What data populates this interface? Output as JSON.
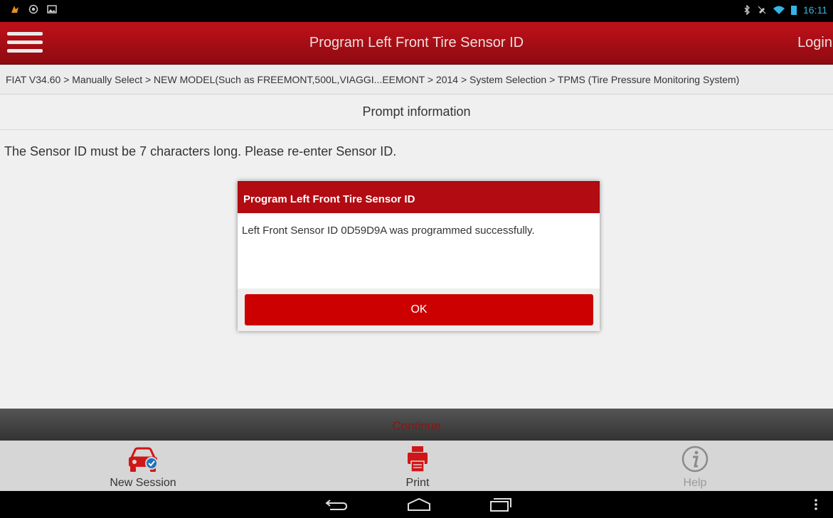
{
  "status_bar": {
    "time": "16:11"
  },
  "header": {
    "title": "Program Left Front Tire Sensor ID",
    "login_label": "Login"
  },
  "breadcrumb": "FIAT V34.60 > Manually Select > NEW MODEL(Such as FREEMONT,500L,VIAGGI...EEMONT > 2014 > System Selection > TPMS (Tire Pressure Monitoring System)",
  "prompt": {
    "heading": "Prompt information",
    "message": "The Sensor ID must be 7 characters long. Please re-enter Sensor ID."
  },
  "dialog": {
    "title": "Program Left Front Tire Sensor ID",
    "message": "Left Front Sensor ID 0D59D9A was programmed successfully.",
    "ok_label": "OK"
  },
  "continue_label": "Continue",
  "toolbar": {
    "new_session": "New Session",
    "print": "Print",
    "help": "Help"
  },
  "colors": {
    "accent": "#b20b12",
    "button": "#cc0000",
    "status_icons": "#33b5e5"
  }
}
